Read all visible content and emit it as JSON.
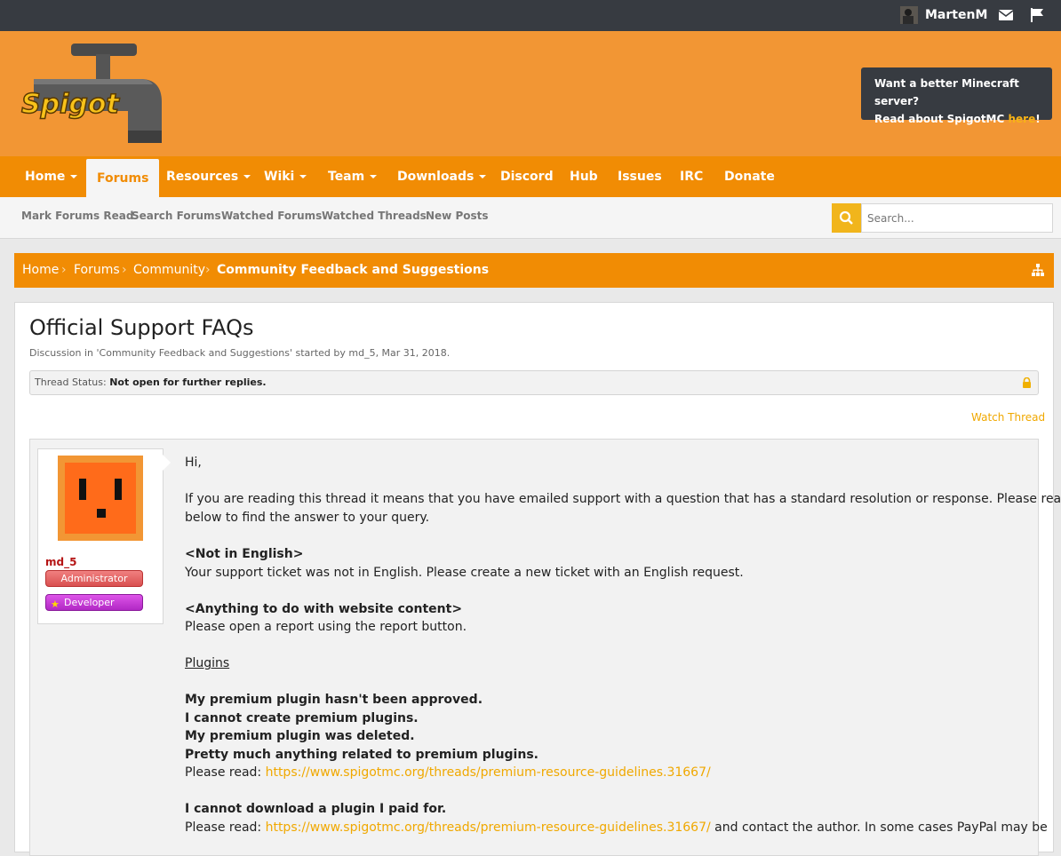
{
  "topbar": {
    "username": "MartenM",
    "icons": [
      "user-avatar",
      "envelope-icon",
      "flag-icon"
    ]
  },
  "header": {
    "logo_text": "Spigot",
    "promo_line1": "Want a better Minecraft server?",
    "promo_line2_prefix": "Read about SpigotMC ",
    "promo_link": "here",
    "promo_suffix": "!"
  },
  "nav": {
    "tabs": [
      {
        "label": "Home",
        "dropdown": true
      },
      {
        "label": "Forums",
        "dropdown": false,
        "active": true
      },
      {
        "label": "Resources",
        "dropdown": true
      },
      {
        "label": "Wiki",
        "dropdown": true
      },
      {
        "label": "Team",
        "dropdown": true
      },
      {
        "label": "Downloads",
        "dropdown": true
      },
      {
        "label": "Discord",
        "dropdown": false
      },
      {
        "label": "Hub",
        "dropdown": false
      },
      {
        "label": "Issues",
        "dropdown": false
      },
      {
        "label": "IRC",
        "dropdown": false
      },
      {
        "label": "Donate",
        "dropdown": false
      }
    ]
  },
  "subnav": {
    "links": [
      "Mark Forums Read",
      "Search Forums",
      "Watched Forums",
      "Watched Threads",
      "New Posts"
    ],
    "search_placeholder": "Search..."
  },
  "breadcrumb": {
    "items": [
      "Home",
      "Forums",
      "Community",
      "Community Feedback and Suggestions"
    ]
  },
  "thread": {
    "title": "Official Support FAQs",
    "description": "Discussion in 'Community Feedback and Suggestions' started by md_5, Mar 31, 2018.",
    "status_label": "Thread Status:",
    "status_value": "Not open for further replies.",
    "watch_label": "Watch Thread"
  },
  "post": {
    "author": "md_5",
    "badges": [
      "Administrator",
      "Developer"
    ],
    "lines": {
      "greeting": "Hi,",
      "intro1": "If you are reading this thread it means that you have emailed support with a question that has a standard resolution or response. Please read",
      "intro2": "below to find the answer to your query.",
      "h_english": "<Not in English>",
      "t_english": "Your support ticket was not in English. Please create a new ticket with an English request.",
      "h_website": "<Anything to do with website content>",
      "t_website": "Please open a report using the report button.",
      "plugins": "Plugins",
      "q1": "My premium plugin hasn't been approved.",
      "q2": "I cannot create premium plugins.",
      "q3": "My premium plugin was deleted.",
      "q4": "Pretty much anything related to premium plugins.",
      "read_label": "Please read: ",
      "link1": "https://www.spigotmc.org/threads/premium-resource-guidelines.31667/",
      "q5": "I cannot download a plugin I paid for.",
      "read_label2": "Please read: ",
      "link2": "https://www.spigotmc.org/threads/premium-resource-guidelines.31667/",
      "tail2": " and contact the author. In some cases PayPal may be"
    }
  },
  "colors": {
    "topbar": "#373b41",
    "header": "#f29634",
    "nav": "#f18c04",
    "link": "#f0a800",
    "search_button": "#f1b51c"
  }
}
